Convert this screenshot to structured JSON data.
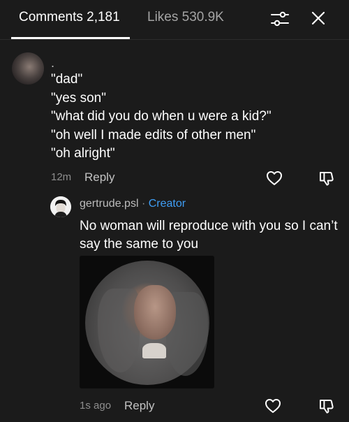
{
  "tabs": {
    "comments": "Comments 2,181",
    "likes": "Likes 530.9K"
  },
  "comment": {
    "author": ".",
    "lines": [
      "\"dad\"",
      "\"yes son\"",
      "\"what did you do when u were a kid?\"",
      "\"oh well I made edits of other men\"",
      "\"oh alright\""
    ],
    "time": "12m",
    "reply_label": "Reply"
  },
  "reply": {
    "author": "gertrude.psl",
    "separator": "·",
    "badge": "Creator",
    "text": "No woman will reproduce with you so I can’t say the same to you",
    "time": "1s ago",
    "reply_label": "Reply"
  },
  "colors": {
    "background": "#1b1b1b",
    "creator_badge": "#3f9ef5",
    "muted_text": "#8e8e8e"
  },
  "icons": {
    "filter": "sliders-filter-icon",
    "close": "close-icon",
    "like": "heart-icon",
    "dislike": "thumbs-down-icon"
  }
}
